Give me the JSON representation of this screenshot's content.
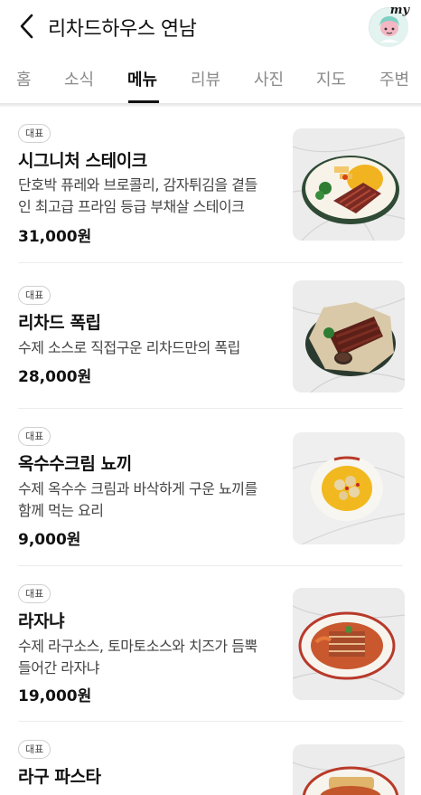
{
  "header": {
    "title": "리차드하우스 연남",
    "my_label": "my"
  },
  "tabs": [
    "홈",
    "소식",
    "메뉴",
    "리뷰",
    "사진",
    "지도",
    "주변"
  ],
  "active_tab": "메뉴",
  "menu_items": [
    {
      "badge": "대표",
      "name": "시그니처 스테이크",
      "description_lines": [
        "단호박 퓨레와 브로콜리, 감자튀김을 곁들",
        "인 최고급 프라임 등급 부채살 스테이크"
      ],
      "price": "31,000원",
      "image": "steak-dish-image"
    },
    {
      "badge": "대표",
      "name": "리차드 폭립",
      "description_lines": [
        "수제 소스로 직접구운 리차드만의 폭립"
      ],
      "price": "28,000원",
      "image": "pork-ribs-image"
    },
    {
      "badge": "대표",
      "name": "옥수수크림 뇨끼",
      "description_lines": [
        "수제 옥수수 크림과 바삭하게 구운 뇨끼를",
        "함께 먹는 요리"
      ],
      "price": "9,000원",
      "image": "gnocchi-image"
    },
    {
      "badge": "대표",
      "name": "라자냐",
      "description_lines": [
        "수제 라구소스, 토마토소스와 치즈가 듬뿍",
        "들어간 라자냐"
      ],
      "price": "19,000원",
      "image": "lasagna-image"
    },
    {
      "badge": "대표",
      "name": "라구 파스타",
      "description_lines": [],
      "price": "",
      "image": "ragu-pasta-image"
    }
  ]
}
